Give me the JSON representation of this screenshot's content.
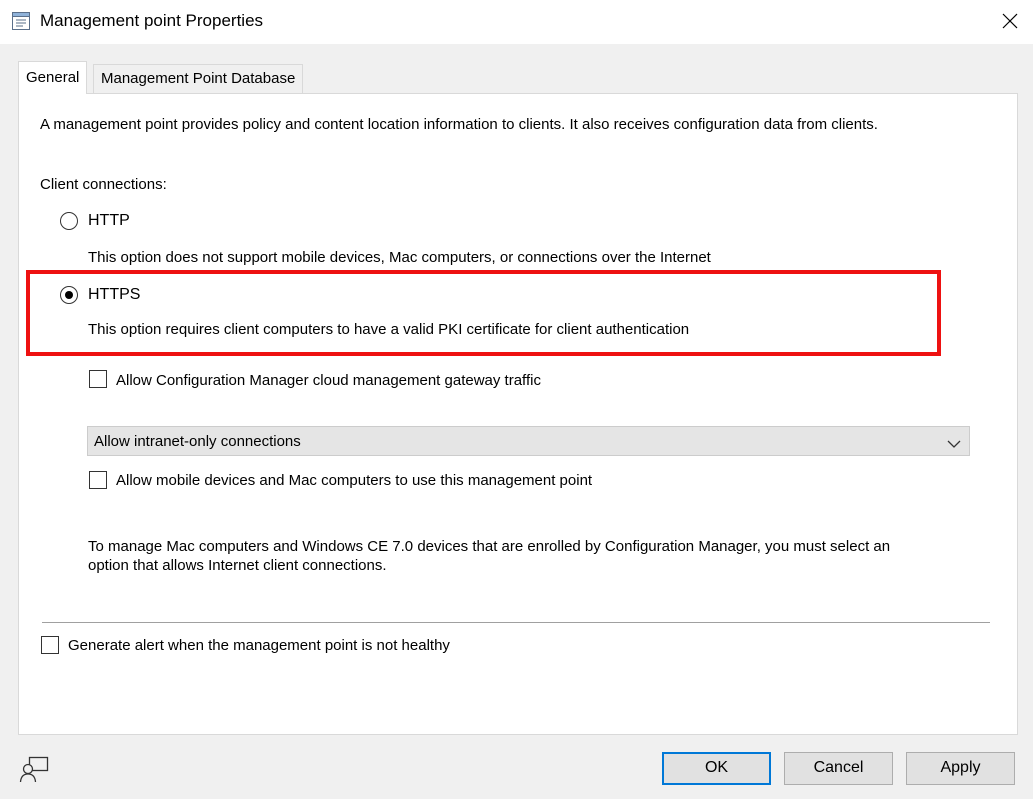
{
  "window": {
    "title": "Management point Properties",
    "icon": "properties-icon",
    "close_icon": "close-icon"
  },
  "tabs": [
    {
      "label": "General",
      "active": true
    },
    {
      "label": "Management Point Database",
      "active": false
    }
  ],
  "general": {
    "description": "A management point provides policy and content location information to clients.  It also receives configuration data from clients.",
    "client_connections_label": "Client connections:",
    "http": {
      "label": "HTTP",
      "description": "This option does not support mobile devices, Mac computers, or connections over the Internet",
      "selected": false
    },
    "https": {
      "label": "HTTPS",
      "description": "This option requires client computers to have a valid PKI certificate for client authentication",
      "selected": true
    },
    "allow_cmg": {
      "label": "Allow Configuration Manager cloud management gateway traffic",
      "checked": false
    },
    "connections_dropdown": {
      "selected": "Allow intranet-only connections"
    },
    "allow_mobile": {
      "label": "Allow mobile devices and Mac computers to use this management point",
      "checked": false
    },
    "mac_note_line1": "To manage Mac computers and Windows CE 7.0 devices that are enrolled by Configuration Manager, you must select an",
    "mac_note_line2": "option that allows Internet client connections.",
    "generate_alert": {
      "label": "Generate alert when the management point is not healthy",
      "checked": false
    }
  },
  "buttons": {
    "ok": "OK",
    "cancel": "Cancel",
    "apply": "Apply"
  },
  "colors": {
    "highlight": "#ee1111",
    "default_button_border": "#0078d7"
  }
}
